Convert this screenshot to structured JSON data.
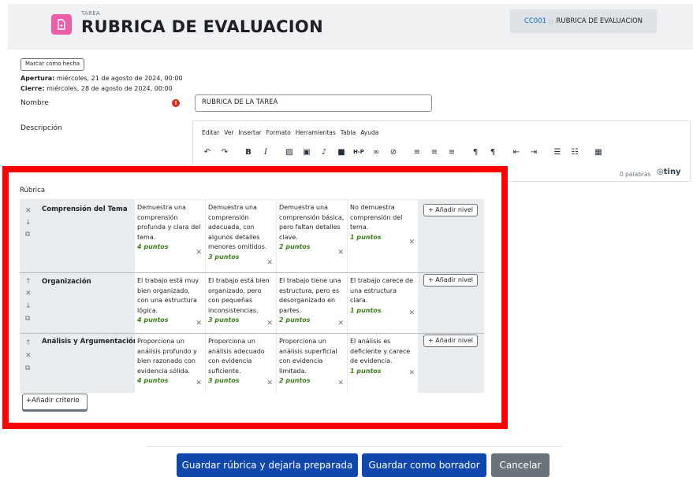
{
  "header": {
    "module_type": "TAREA",
    "title": "RUBRICA DE EVALUACION",
    "breadcrumb": [
      "CC001",
      "RUBRICA DE EVALUACION"
    ]
  },
  "completion": {
    "mark_done_label": "Marcar como hecha"
  },
  "dates": {
    "opening_label": "Apertura:",
    "opening_value": " miércoles, 21 de agosto de 2024, 00:00",
    "closing_label": "Cierre:",
    "closing_value": " miércoles, 28 de agosto de 2024, 00:00"
  },
  "form": {
    "name_label": "Nombre",
    "name_value": "RUBRICA DE LA TAREA",
    "description_label": "Descripción"
  },
  "editor": {
    "menu": [
      "Editar",
      "Ver",
      "Insertar",
      "Formato",
      "Herramientas",
      "Tabla",
      "Ayuda"
    ],
    "word_count": "0 palabras",
    "brand": "tiny"
  },
  "rubric": {
    "label": "Rúbrica",
    "add_level_label": "+ Añadir nivel",
    "add_criterion_label": "+Añadir criterio",
    "criteria": [
      {
        "name": "Comprensión del Tema",
        "levels": [
          {
            "text": "Demuestra una comprensión profunda y clara del tema.",
            "points": "4 puntos"
          },
          {
            "text": "Demuestra una comprensión adecuada, con algunos detalles menores omitidos.",
            "points": "3 puntos"
          },
          {
            "text": "Demuestra una comprensión básica, pero faltan detalles clave.",
            "points": "2 puntos"
          },
          {
            "text": "No demuestra comprensión del tema.",
            "points": "1 puntos"
          }
        ]
      },
      {
        "name": "Organización",
        "levels": [
          {
            "text": "El trabajo está muy bien organizado, con una estructura lógica.",
            "points": "4 puntos"
          },
          {
            "text": "El trabajo está bien organizado, pero con pequeñas inconsistencias.",
            "points": "3 puntos"
          },
          {
            "text": "El trabajo tiene una estructura, pero es desorganizado en partes.",
            "points": "2 puntos"
          },
          {
            "text": "El trabajo carece de una estructura clara.",
            "points": "1 puntos"
          }
        ]
      },
      {
        "name": "Análisis y Argumentación",
        "levels": [
          {
            "text": "Proporciona un análisis profundo y bien razonado con evidencia sólida.",
            "points": "4 puntos"
          },
          {
            "text": "Proporciona un análisis adecuado con evidencia suficiente.",
            "points": "3 puntos"
          },
          {
            "text": "Proporciona un análisis superficial con evidencia limitada.",
            "points": "2 puntos"
          },
          {
            "text": "El análisis es deficiente y carece de evidencia.",
            "points": "1 puntos"
          }
        ]
      }
    ]
  },
  "actions": {
    "save_ready": "Guardar rúbrica y dejarla preparada",
    "save_draft": "Guardar como borrador",
    "cancel": "Cancelar"
  },
  "colors": {
    "primary": "#0f47ad",
    "secondary": "#6a737b",
    "tarea_icon": "#ec5ea8",
    "highlight": "#ff0000",
    "points": "#3f7e1e"
  }
}
